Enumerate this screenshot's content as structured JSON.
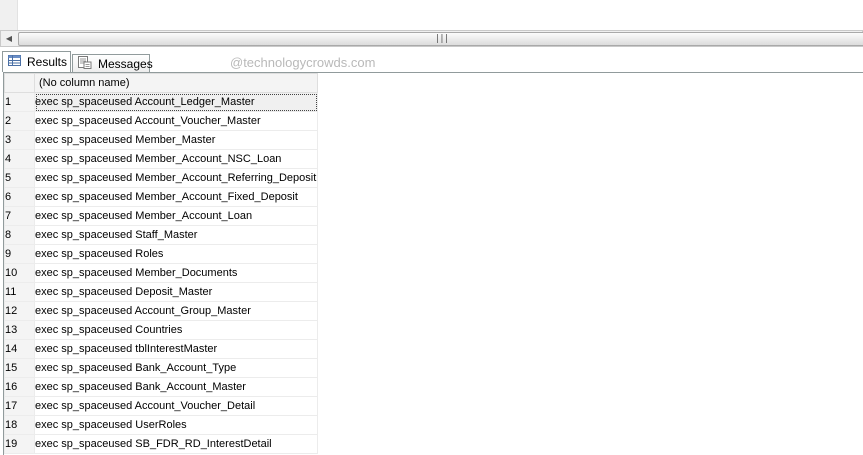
{
  "tabs": {
    "results_label": "Results",
    "messages_label": "Messages"
  },
  "watermark": "@technologycrowds.com",
  "grid": {
    "column_header": "(No column name)",
    "rows": [
      {
        "num": "1",
        "value": "exec sp_spaceused Account_Ledger_Master"
      },
      {
        "num": "2",
        "value": "exec sp_spaceused Account_Voucher_Master"
      },
      {
        "num": "3",
        "value": "exec sp_spaceused Member_Master"
      },
      {
        "num": "4",
        "value": "exec sp_spaceused Member_Account_NSC_Loan"
      },
      {
        "num": "5",
        "value": "exec sp_spaceused Member_Account_Referring_Deposit"
      },
      {
        "num": "6",
        "value": "exec sp_spaceused Member_Account_Fixed_Deposit"
      },
      {
        "num": "7",
        "value": "exec sp_spaceused Member_Account_Loan"
      },
      {
        "num": "8",
        "value": "exec sp_spaceused Staff_Master"
      },
      {
        "num": "9",
        "value": "exec sp_spaceused Roles"
      },
      {
        "num": "10",
        "value": "exec sp_spaceused Member_Documents"
      },
      {
        "num": "11",
        "value": "exec sp_spaceused Deposit_Master"
      },
      {
        "num": "12",
        "value": "exec sp_spaceused Account_Group_Master"
      },
      {
        "num": "13",
        "value": "exec sp_spaceused Countries"
      },
      {
        "num": "14",
        "value": "exec sp_spaceused tblInterestMaster"
      },
      {
        "num": "15",
        "value": "exec sp_spaceused Bank_Account_Type"
      },
      {
        "num": "16",
        "value": "exec sp_spaceused Bank_Account_Master"
      },
      {
        "num": "17",
        "value": "exec sp_spaceused Account_Voucher_Detail"
      },
      {
        "num": "18",
        "value": "exec sp_spaceused UserRoles"
      },
      {
        "num": "19",
        "value": "exec sp_spaceused SB_FDR_RD_InterestDetail"
      }
    ]
  }
}
